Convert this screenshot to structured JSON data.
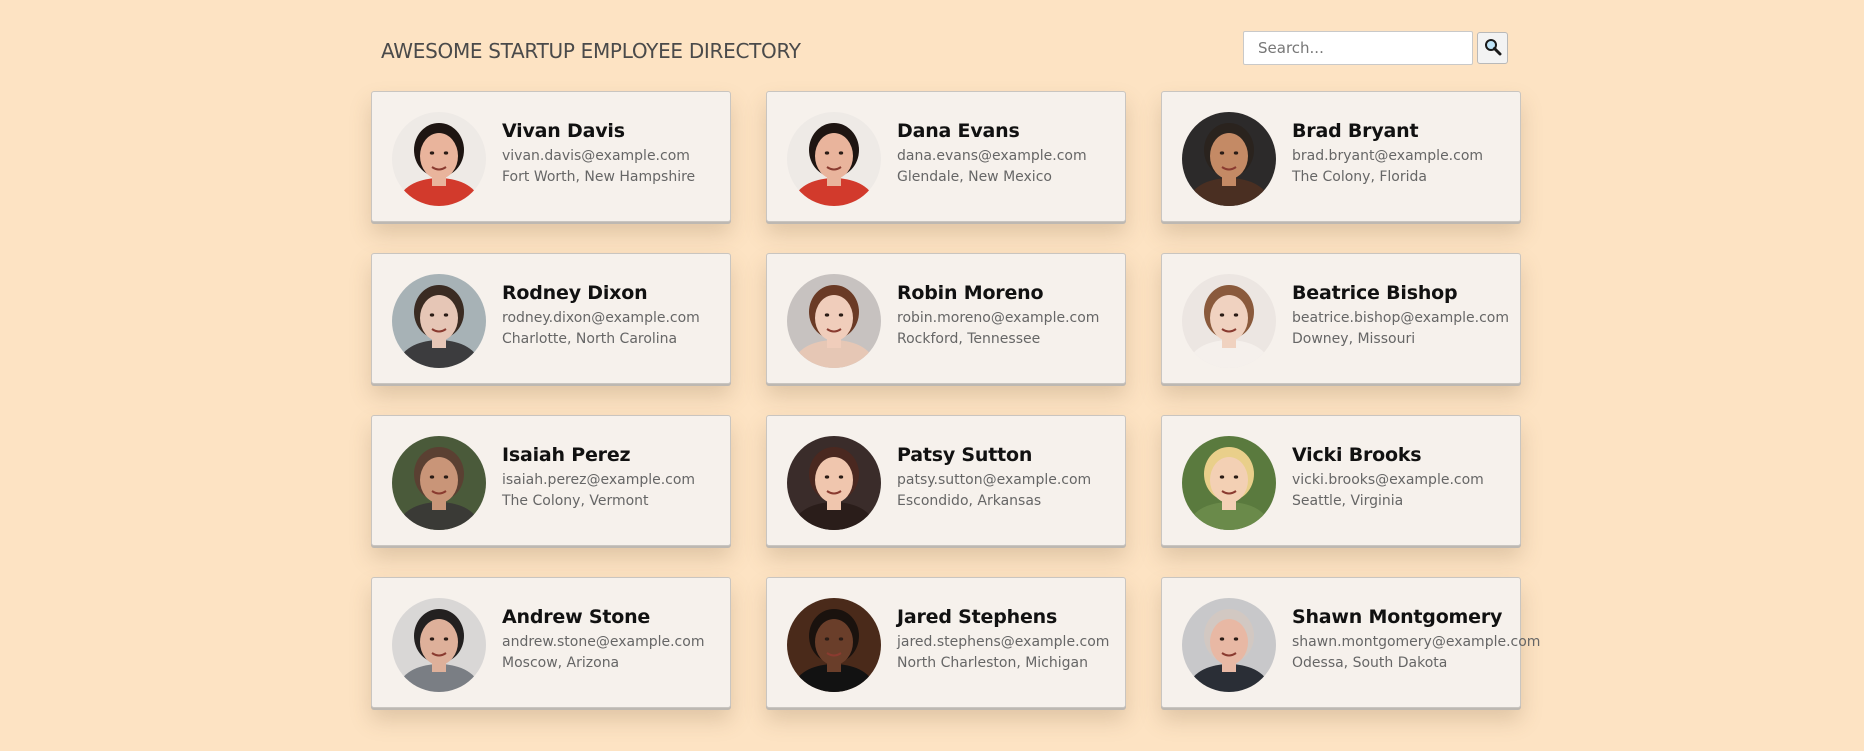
{
  "header": {
    "title": "AWESOME STARTUP EMPLOYEE DIRECTORY"
  },
  "search": {
    "placeholder": "Search...",
    "value": "",
    "button_icon": "search-icon"
  },
  "employees": [
    {
      "name": "Vivan Davis",
      "email": "vivan.davis@example.com",
      "location": "Fort Worth, New Hampshire",
      "bg": "#eeeae6",
      "skin": "#e9b49c",
      "hair": "#1e1512",
      "shirt": "#d23a2c"
    },
    {
      "name": "Dana Evans",
      "email": "dana.evans@example.com",
      "location": "Glendale, New Mexico",
      "bg": "#eeeae6",
      "skin": "#e9b49c",
      "hair": "#1e1512",
      "shirt": "#d23a2c"
    },
    {
      "name": "Brad Bryant",
      "email": "brad.bryant@example.com",
      "location": "The Colony, Florida",
      "bg": "#2c2a2a",
      "skin": "#c48a65",
      "hair": "#2a231e",
      "shirt": "#4a2f22"
    },
    {
      "name": "Rodney Dixon",
      "email": "rodney.dixon@example.com",
      "location": "Charlotte, North Carolina",
      "bg": "#a7b2b6",
      "skin": "#e6c6b6",
      "hair": "#3a2b22",
      "shirt": "#3c3c3e"
    },
    {
      "name": "Robin Moreno",
      "email": "robin.moreno@example.com",
      "location": "Rockford, Tennessee",
      "bg": "#c7c2c0",
      "skin": "#f0cdbb",
      "hair": "#6a3a25",
      "shirt": "#e6c7b5"
    },
    {
      "name": "Beatrice Bishop",
      "email": "beatrice.bishop@example.com",
      "location": "Downey, Missouri",
      "bg": "#ece6e2",
      "skin": "#f0d2c0",
      "hair": "#8a5a3c",
      "shirt": "#f5f0ec"
    },
    {
      "name": "Isaiah Perez",
      "email": "isaiah.perez@example.com",
      "location": "The Colony, Vermont",
      "bg": "#4a5a3a",
      "skin": "#c99578",
      "hair": "#5a4032",
      "shirt": "#3a3a36"
    },
    {
      "name": "Patsy Sutton",
      "email": "patsy.sutton@example.com",
      "location": "Escondido, Arkansas",
      "bg": "#3a2c2a",
      "skin": "#f0c6ae",
      "hair": "#4a2820",
      "shirt": "#2a1d1a"
    },
    {
      "name": "Vicki Brooks",
      "email": "vicki.brooks@example.com",
      "location": "Seattle, Virginia",
      "bg": "#5a7a3e",
      "skin": "#f3d0b4",
      "hair": "#e9cf8a",
      "shirt": "#6a8a4a"
    },
    {
      "name": "Andrew Stone",
      "email": "andrew.stone@example.com",
      "location": "Moscow, Arizona",
      "bg": "#d9d7d6",
      "skin": "#deb09a",
      "hair": "#232020",
      "shirt": "#7a7e84"
    },
    {
      "name": "Jared Stephens",
      "email": "jared.stephens@example.com",
      "location": "North Charleston, Michigan",
      "bg": "#4a2a1a",
      "skin": "#6a3e2a",
      "hair": "#1a120e",
      "shirt": "#121212"
    },
    {
      "name": "Shawn Montgomery",
      "email": "shawn.montgomery@example.com",
      "location": "Odessa, South Dakota",
      "bg": "#c8c8ca",
      "skin": "#e8b8a4",
      "hair": "#d2c8c2",
      "shirt": "#2a2e36"
    }
  ]
}
